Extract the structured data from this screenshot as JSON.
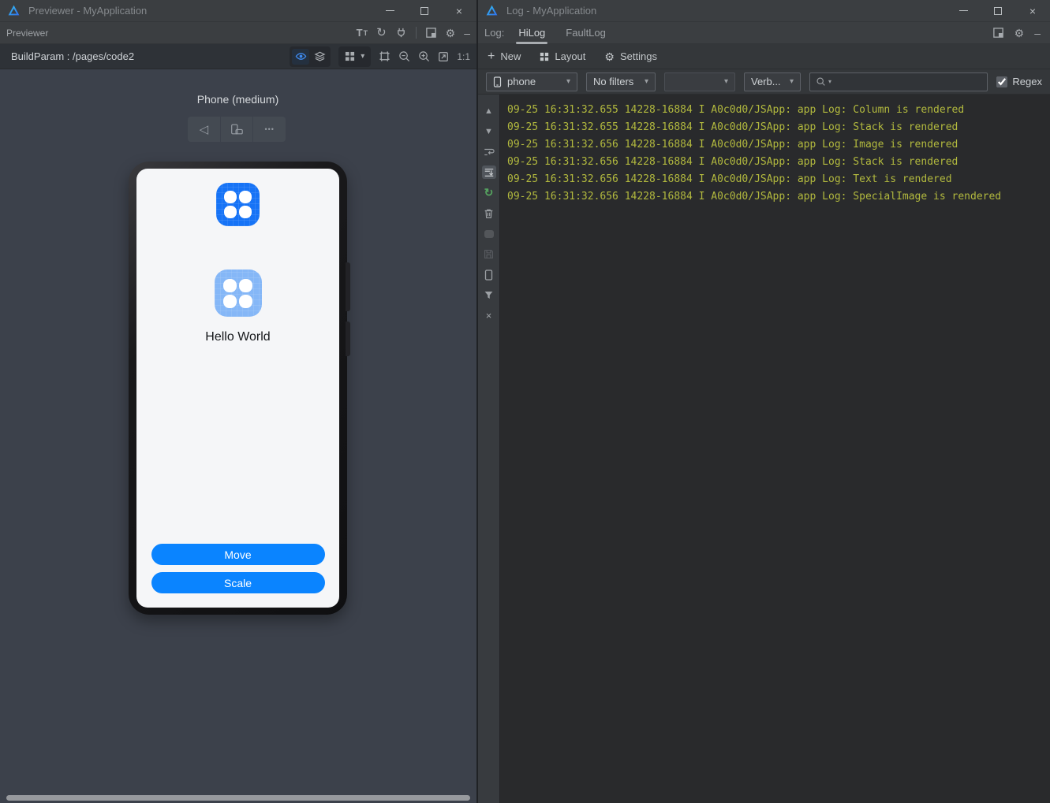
{
  "previewer_window": {
    "title": "Previewer - MyApplication",
    "panel_label": "Previewer",
    "buildparam_label": "BuildParam : /pages/code2",
    "zoom_ratio_label": "1:1",
    "device_label": "Phone (medium)",
    "screen": {
      "app_title": "Hello World",
      "buttons": [
        {
          "label": "Move"
        },
        {
          "label": "Scale"
        }
      ]
    }
  },
  "log_window": {
    "title": "Log - MyApplication",
    "tab_bar": {
      "label": "Log:",
      "tabs": [
        {
          "label": "HiLog"
        },
        {
          "label": "FaultLog"
        }
      ]
    },
    "toolbar": {
      "new_label": "New",
      "layout_label": "Layout",
      "settings_label": "Settings"
    },
    "filter_bar": {
      "device_select": "phone",
      "filter_select": "No filters",
      "empty_select": "",
      "level_select": "Verb...",
      "search_value": "",
      "regex_label": "Regex",
      "regex_checked": true
    },
    "log_lines": [
      "09-25 16:31:32.655 14228-16884 I A0c0d0/JSApp: app Log: Column is rendered",
      "09-25 16:31:32.655 14228-16884 I A0c0d0/JSApp: app Log: Stack is rendered",
      "09-25 16:31:32.656 14228-16884 I A0c0d0/JSApp: app Log: Image is rendered",
      "09-25 16:31:32.656 14228-16884 I A0c0d0/JSApp: app Log: Stack is rendered",
      "09-25 16:31:32.656 14228-16884 I A0c0d0/JSApp: app Log: Text is rendered",
      "09-25 16:31:32.656 14228-16884 I A0c0d0/JSApp: app Log: SpecialImage is rendered"
    ]
  },
  "glyphs": {
    "minimize": "–",
    "close": "×",
    "letter_t": "T",
    "refresh": "↻",
    "gear": "⚙",
    "caret_down": "▾",
    "back_triangle": "◁",
    "ellipsis": "•••",
    "plus": "+",
    "up_triangle": "▲",
    "down_triangle": "▼",
    "restart": "↻",
    "close_small": "×"
  },
  "colors": {
    "accent_blue": "#0a84ff",
    "app_icon_blue": "#1673f6",
    "app_icon_light_blue": "#85b7f7",
    "log_text": "#b2b93e",
    "restart_green": "#55a35f",
    "eye_toggle_blue": "#3f8cf3"
  }
}
